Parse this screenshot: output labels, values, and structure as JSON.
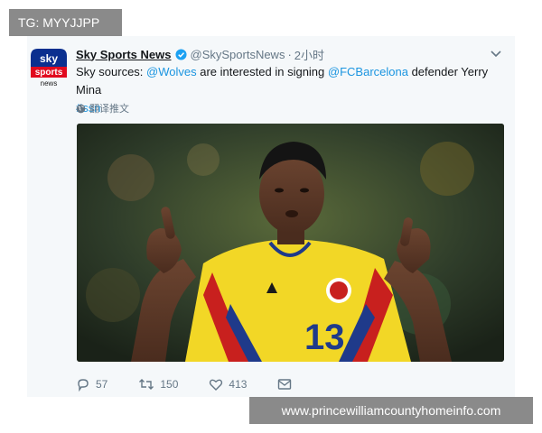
{
  "watermarks": {
    "top_left": "TG: MYYJJPP",
    "bottom_right": "www.princewilliamcountyhomeinfo.com"
  },
  "tweet": {
    "author_name": "Sky Sports News",
    "handle": "@SkySportsNews",
    "separator": "·",
    "time": "2小时",
    "text_pre": "Sky sources: ",
    "mention_1": "@Wolves",
    "text_mid": " are interested in signing ",
    "mention_2": "@FCBarcelona",
    "text_post": " defender Yerry Mina",
    "hashtag": "#ssn",
    "translate_label": "翻译推文",
    "avatar_logo": {
      "line1": "sky",
      "line2": "sports",
      "line3": "news"
    },
    "photo_jersey_number": "13",
    "actions": {
      "replies": "57",
      "retweets": "150",
      "likes": "413"
    },
    "icons": [
      "verified-icon",
      "chevron-down-icon",
      "globe-icon",
      "reply-icon",
      "retweet-icon",
      "like-icon",
      "message-icon"
    ]
  },
  "colors": {
    "link": "#1b95e0",
    "muted": "#657786",
    "card_bg": "#f5f8fa",
    "watermark_bg": "#8a8a8a"
  }
}
